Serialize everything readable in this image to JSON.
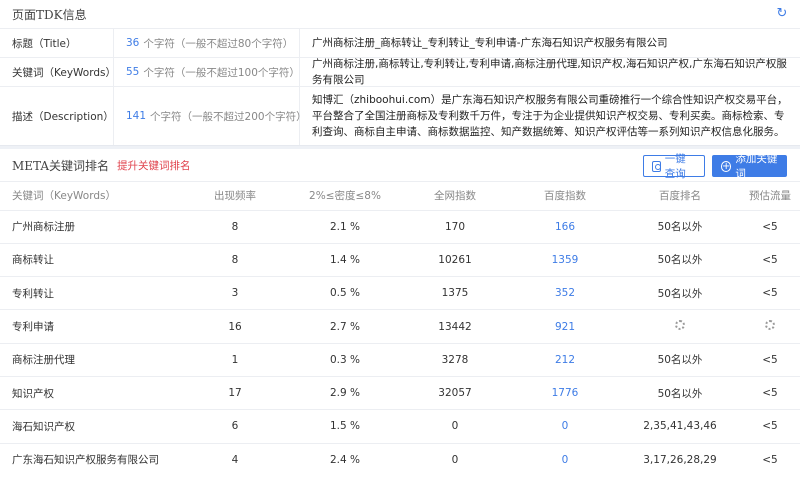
{
  "tdk": {
    "title": "页面TDK信息",
    "refresh_icon": "refresh-icon",
    "rows": [
      {
        "label": "标题（Title）",
        "count": "36",
        "count_text": "个字符（一般不超过80个字符）",
        "value": "广州商标注册_商标转让_专利转让_专利申请-广东海石知识产权服务有限公司"
      },
      {
        "label": "关键词（KeyWords）",
        "count": "55",
        "count_text": "个字符（一般不超过100个字符）",
        "value": "广州商标注册,商标转让,专利转让,专利申请,商标注册代理,知识产权,海石知识产权,广东海石知识产权服务有限公司"
      },
      {
        "label": "描述（Description）",
        "count": "141",
        "count_text": "个字符（一般不超过200个字符）",
        "value": "知博汇（zhiboohui.com）是广东海石知识产权服务有限公司重磅推行一个综合性知识产权交易平台，平台整合了全国注册商标及专利数千万件，专注于为企业提供知识产权交易、专利买卖。商标检索、专利查询、商标自主申请、商标数据监控、知产数据统筹、知识产权评估等一系列知识产权信息化服务。"
      }
    ]
  },
  "meta": {
    "title": "META关键词排名",
    "promo": "提升关键词排名",
    "btn_query": "一键查询",
    "btn_add": "添加关键词",
    "headers": [
      "关键词（KeyWords）",
      "出现频率",
      "2%≤密度≤8%",
      "全网指数",
      "百度指数",
      "百度排名",
      "预估流量"
    ],
    "rows": [
      {
        "keyword": "广州商标注册",
        "freq": "8",
        "density": "2.1 %",
        "index": "170",
        "baidu_index": "166",
        "rank": "50名以外",
        "traffic": "<5"
      },
      {
        "keyword": "商标转让",
        "freq": "8",
        "density": "1.4 %",
        "index": "10261",
        "baidu_index": "1359",
        "rank": "50名以外",
        "traffic": "<5"
      },
      {
        "keyword": "专利转让",
        "freq": "3",
        "density": "0.5 %",
        "index": "1375",
        "baidu_index": "352",
        "rank": "50名以外",
        "traffic": "<5"
      },
      {
        "keyword": "专利申请",
        "freq": "16",
        "density": "2.7 %",
        "index": "13442",
        "baidu_index": "921",
        "rank": "",
        "traffic": ""
      },
      {
        "keyword": "商标注册代理",
        "freq": "1",
        "density": "0.3 %",
        "index": "3278",
        "baidu_index": "212",
        "rank": "50名以外",
        "traffic": "<5"
      },
      {
        "keyword": "知识产权",
        "freq": "17",
        "density": "2.9 %",
        "index": "32057",
        "baidu_index": "1776",
        "rank": "50名以外",
        "traffic": "<5"
      },
      {
        "keyword": "海石知识产权",
        "freq": "6",
        "density": "1.5 %",
        "index": "0",
        "baidu_index": "0",
        "rank": "2,35,41,43,46",
        "traffic": "<5"
      },
      {
        "keyword": "广东海石知识产权服务有限公司",
        "freq": "4",
        "density": "2.4 %",
        "index": "0",
        "baidu_index": "0",
        "rank": "3,17,26,28,29",
        "traffic": "<5"
      }
    ]
  }
}
